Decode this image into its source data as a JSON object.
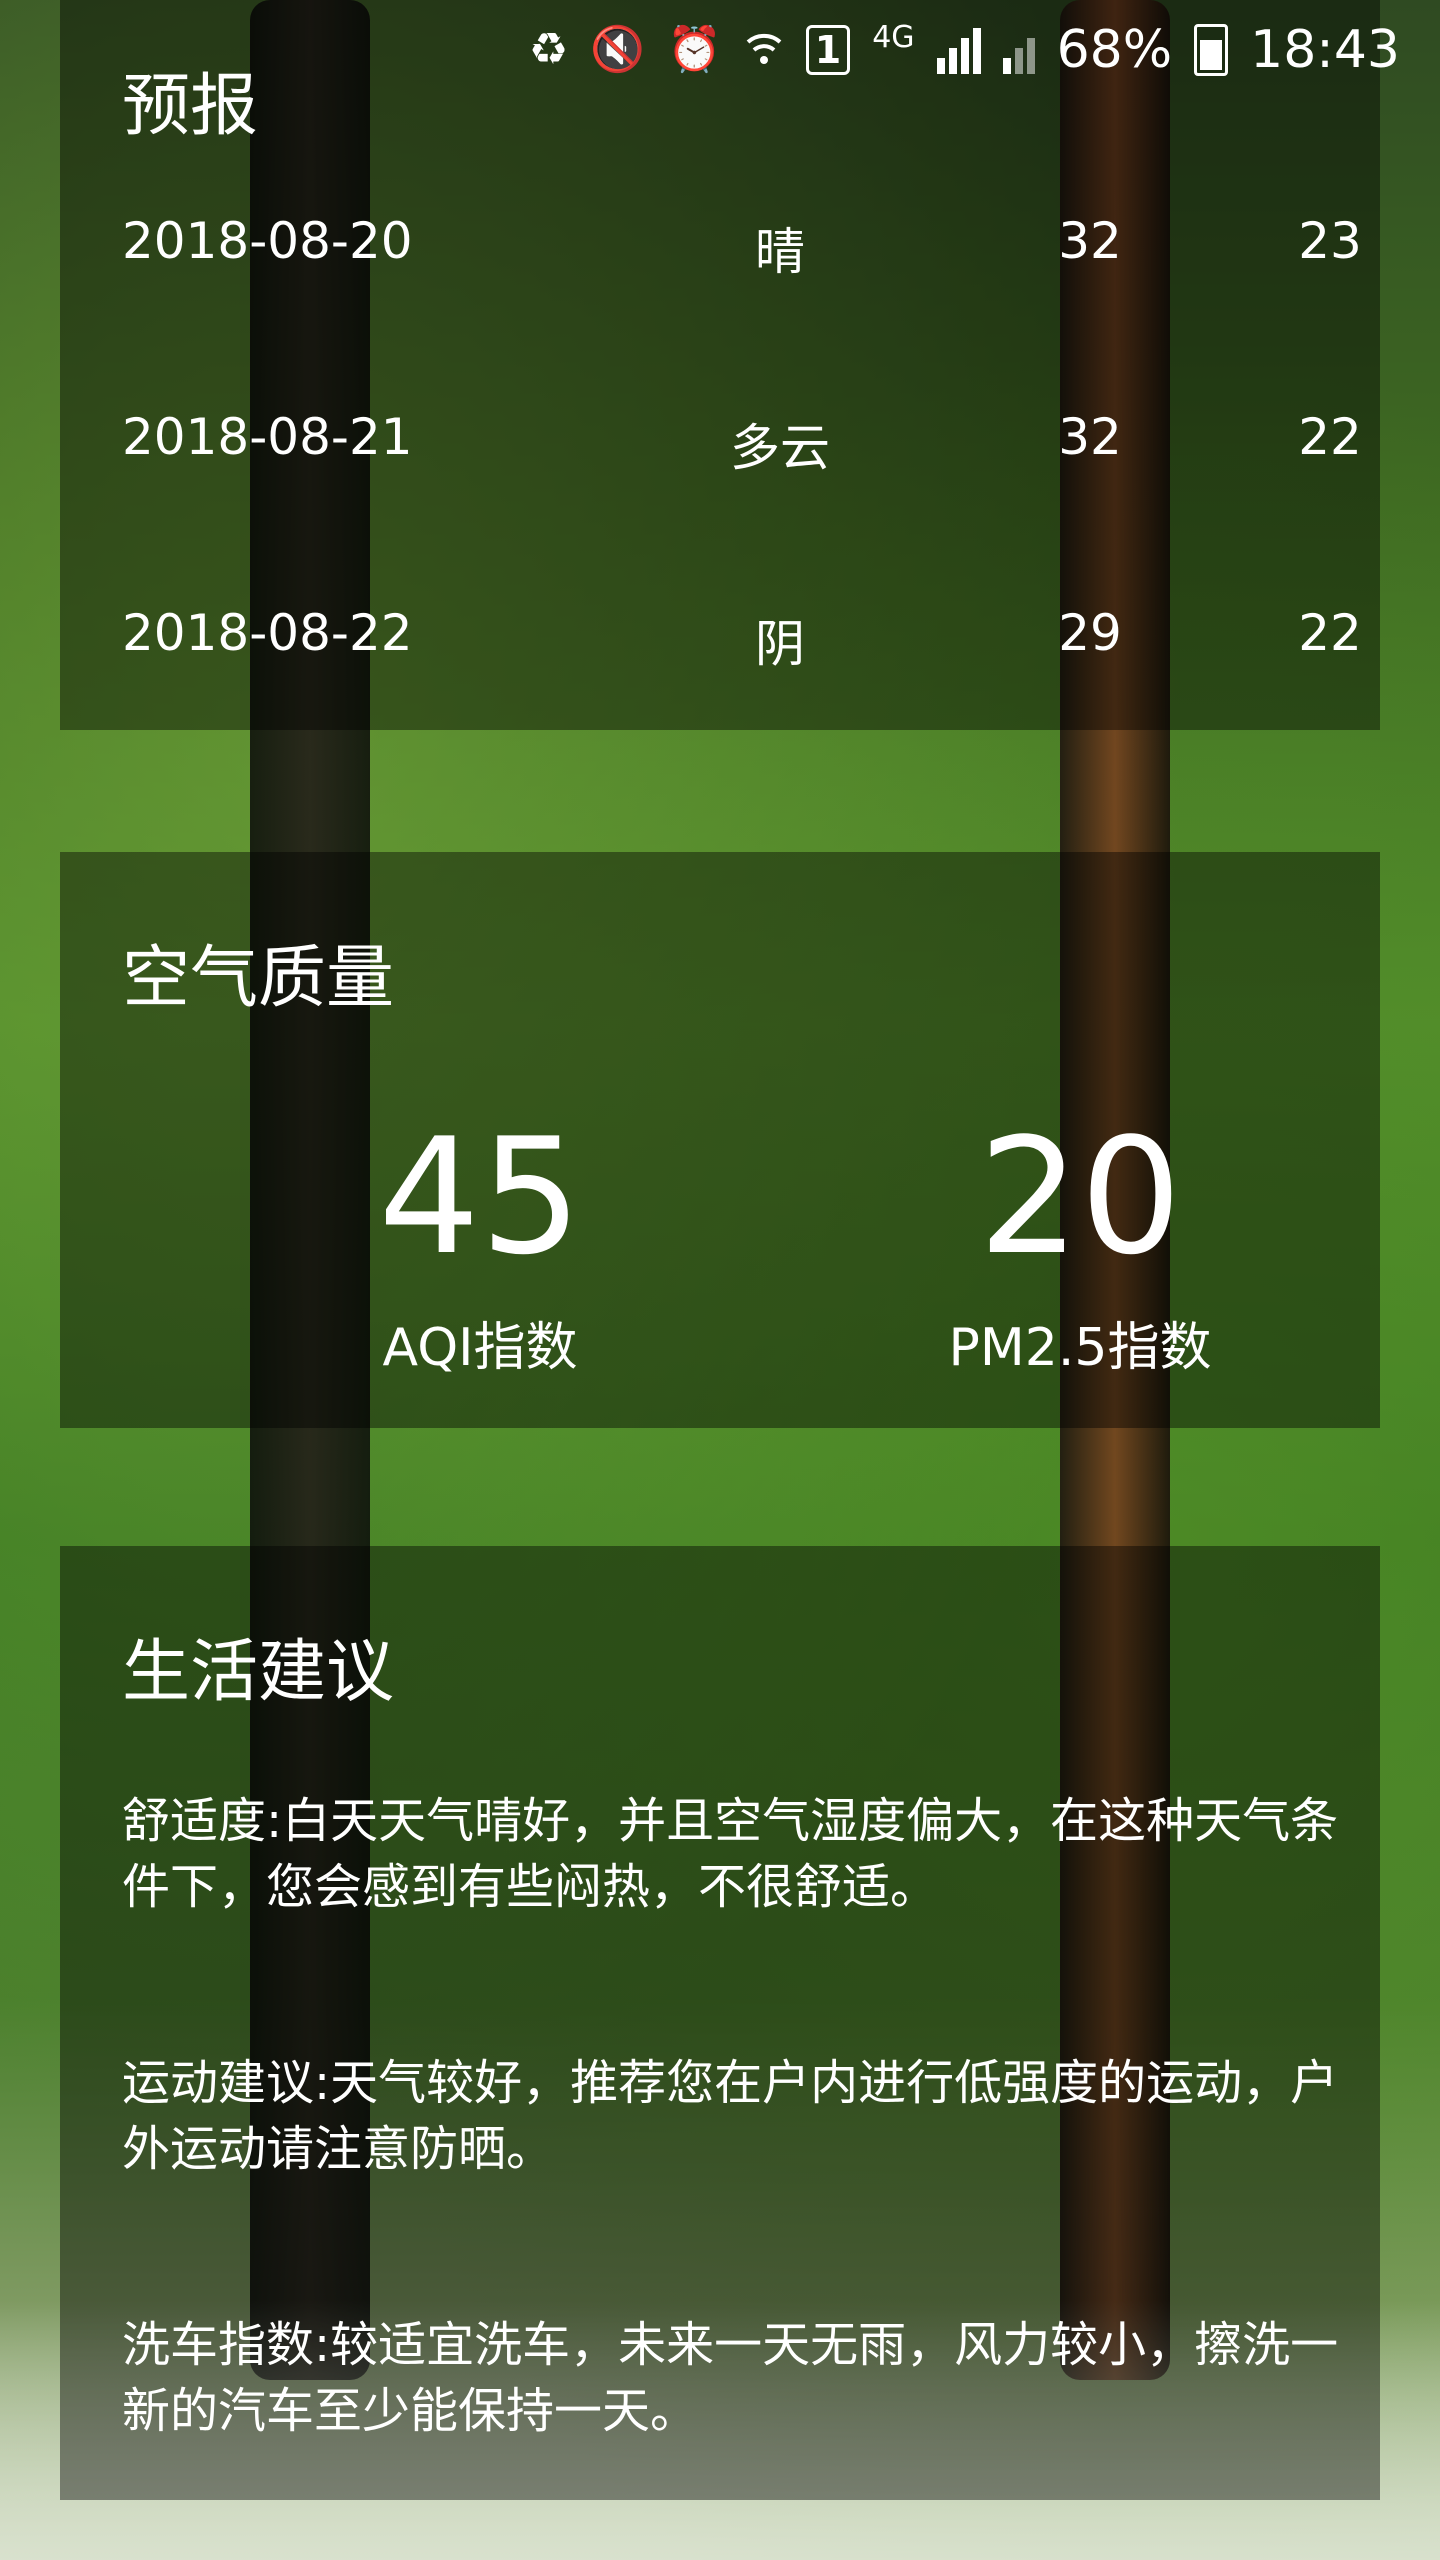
{
  "status_bar": {
    "sim_slot": "1",
    "network": "4G",
    "battery": "68%",
    "time": "18:43"
  },
  "forecast": {
    "title": "预报",
    "rows": [
      {
        "date": "2018-08-20",
        "condition": "晴",
        "high": "32",
        "low": "23"
      },
      {
        "date": "2018-08-21",
        "condition": "多云",
        "high": "32",
        "low": "22"
      },
      {
        "date": "2018-08-22",
        "condition": "阴",
        "high": "29",
        "low": "22"
      }
    ]
  },
  "air_quality": {
    "title": "空气质量",
    "aqi_value": "45",
    "aqi_label": "AQI指数",
    "pm25_value": "20",
    "pm25_label": "PM2.5指数"
  },
  "suggestion": {
    "title": "生活建议",
    "comfort": "舒适度:白天天气晴好，并且空气湿度偏大，在这种天气条件下，您会感到有些闷热，不很舒适。",
    "sport": "运动建议:天气较好，推荐您在户内进行低强度的运动，户外运动请注意防晒。",
    "car_wash": "洗车指数:较适宜洗车，未来一天无雨，风力较小，擦洗一新的汽车至少能保持一天。"
  }
}
